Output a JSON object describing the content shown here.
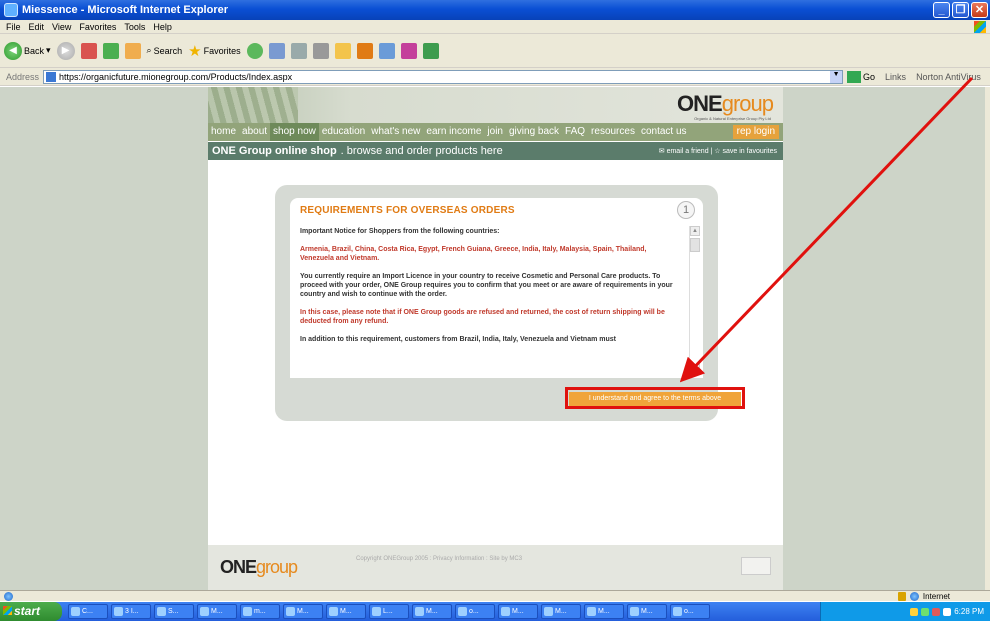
{
  "window": {
    "title": "Miessence - Microsoft Internet Explorer",
    "controls": [
      "_",
      "❐",
      "✕"
    ]
  },
  "menu": [
    "File",
    "Edit",
    "View",
    "Favorites",
    "Tools",
    "Help"
  ],
  "toolbar": {
    "back_label": "Back",
    "search_label": "Search",
    "favorites_label": "Favorites"
  },
  "address": {
    "label": "Address",
    "url": "https://organicfuture.mionegroup.com/Products/Index.aspx",
    "go_label": "Go",
    "links_label": "Links",
    "norton_label": "Norton AntiVirus"
  },
  "site": {
    "logo_main": "ONE",
    "logo_accent": "group",
    "logo_sub": "Organic & Natural Enterprise Group Pty Ltd",
    "nav": [
      "home",
      "about",
      "shop now",
      "education",
      "what's new",
      "earn income",
      "join",
      "giving back",
      "FAQ",
      "resources",
      "contact us"
    ],
    "rep_login": "rep login",
    "shop_title": "ONE Group online shop",
    "shop_subtitle": ". browse and order products here",
    "shop_links": "✉ email a friend | ☆ save in favourites"
  },
  "dialog": {
    "title": "REQUIREMENTS FOR OVERSEAS ORDERS",
    "step": "1",
    "notice": "Important Notice for Shoppers from the following countries:",
    "countries": "Armenia, Brazil, China, Costa Rica, Egypt, French Guiana, Greece, India, Italy, Malaysia, Spain, Thailand, Venezuela and Vietnam.",
    "licence_text": "You currently require an Import Licence in your country to receive Cosmetic and Personal Care products. To proceed with your order, ONE Group requires you to confirm that you meet or are aware of requirements in your country and wish to continue with the order.",
    "refund_text": "In this case, please note that if ONE Group goods are refused and returned, the cost of return shipping will be deducted from any refund.",
    "addition_text": "In addition to this requirement, customers from Brazil, India, Italy, Venezuela and Vietnam must",
    "agree_button": "I understand and agree to the terms above"
  },
  "footer": {
    "logo_main": "ONE",
    "logo_accent": "group",
    "copyright": "Copyright ONEGroup 2005 : Privacy Information : Site by MC3"
  },
  "statusbar": {
    "zone": "Internet"
  },
  "taskbar": {
    "start_label": "start",
    "tasks": [
      "C...",
      "3 I...",
      "S...",
      "M...",
      "m...",
      "M...",
      "M...",
      "L...",
      "M...",
      "o...",
      "M...",
      "M...",
      "M...",
      "M...",
      "o..."
    ],
    "clock": "6:28 PM"
  },
  "colors": {
    "accent_orange": "#e07b14",
    "nav_green": "#92a47a",
    "annotation_red": "#e0110e"
  }
}
